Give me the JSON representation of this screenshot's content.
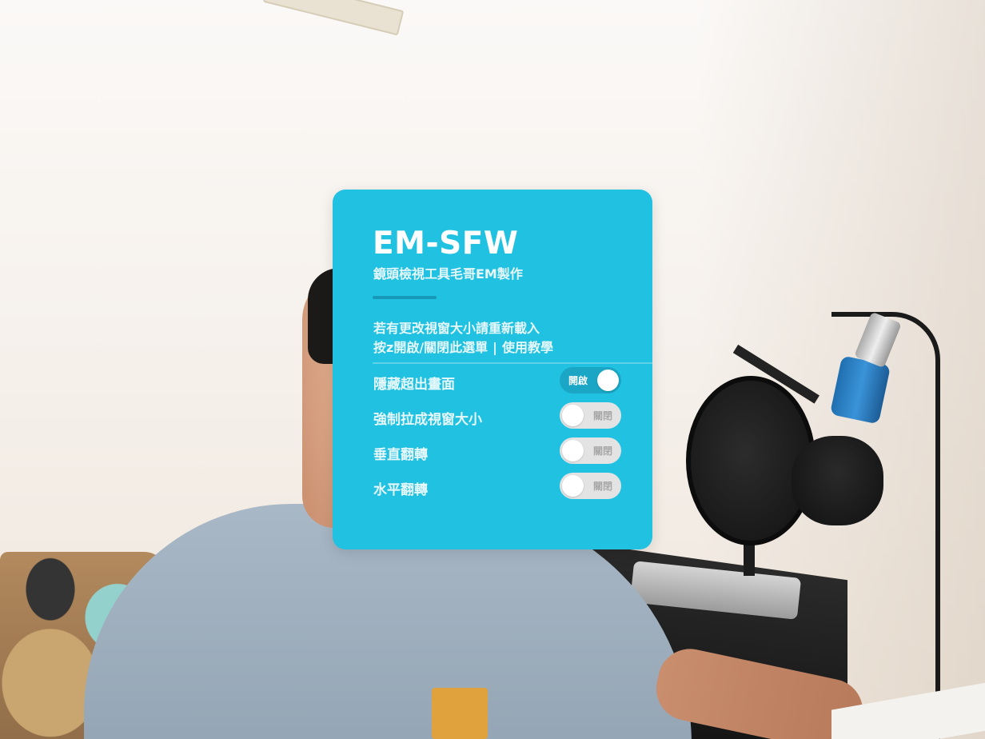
{
  "panel": {
    "title": "EM-SFW",
    "subtitle": "鏡頭檢視工具毛哥EM製作",
    "note_line1": "若有更改視窗大小請重新載入",
    "note_line2_prefix": "按z開啟/關閉此選單",
    "separator": "|",
    "tutorial_link": "使用教學"
  },
  "options": [
    {
      "label": "隱藏超出畫面",
      "state": "開啟",
      "on": true
    },
    {
      "label": "強制拉成視窗大小",
      "state": "關閉",
      "on": false
    },
    {
      "label": "垂直翻轉",
      "state": "關閉",
      "on": false
    },
    {
      "label": "水平翻轉",
      "state": "關閉",
      "on": false
    }
  ],
  "colors": {
    "panel_bg": "#21c1e1",
    "toggle_on": "#1aa6c4",
    "toggle_off": "#e3e3e3"
  }
}
